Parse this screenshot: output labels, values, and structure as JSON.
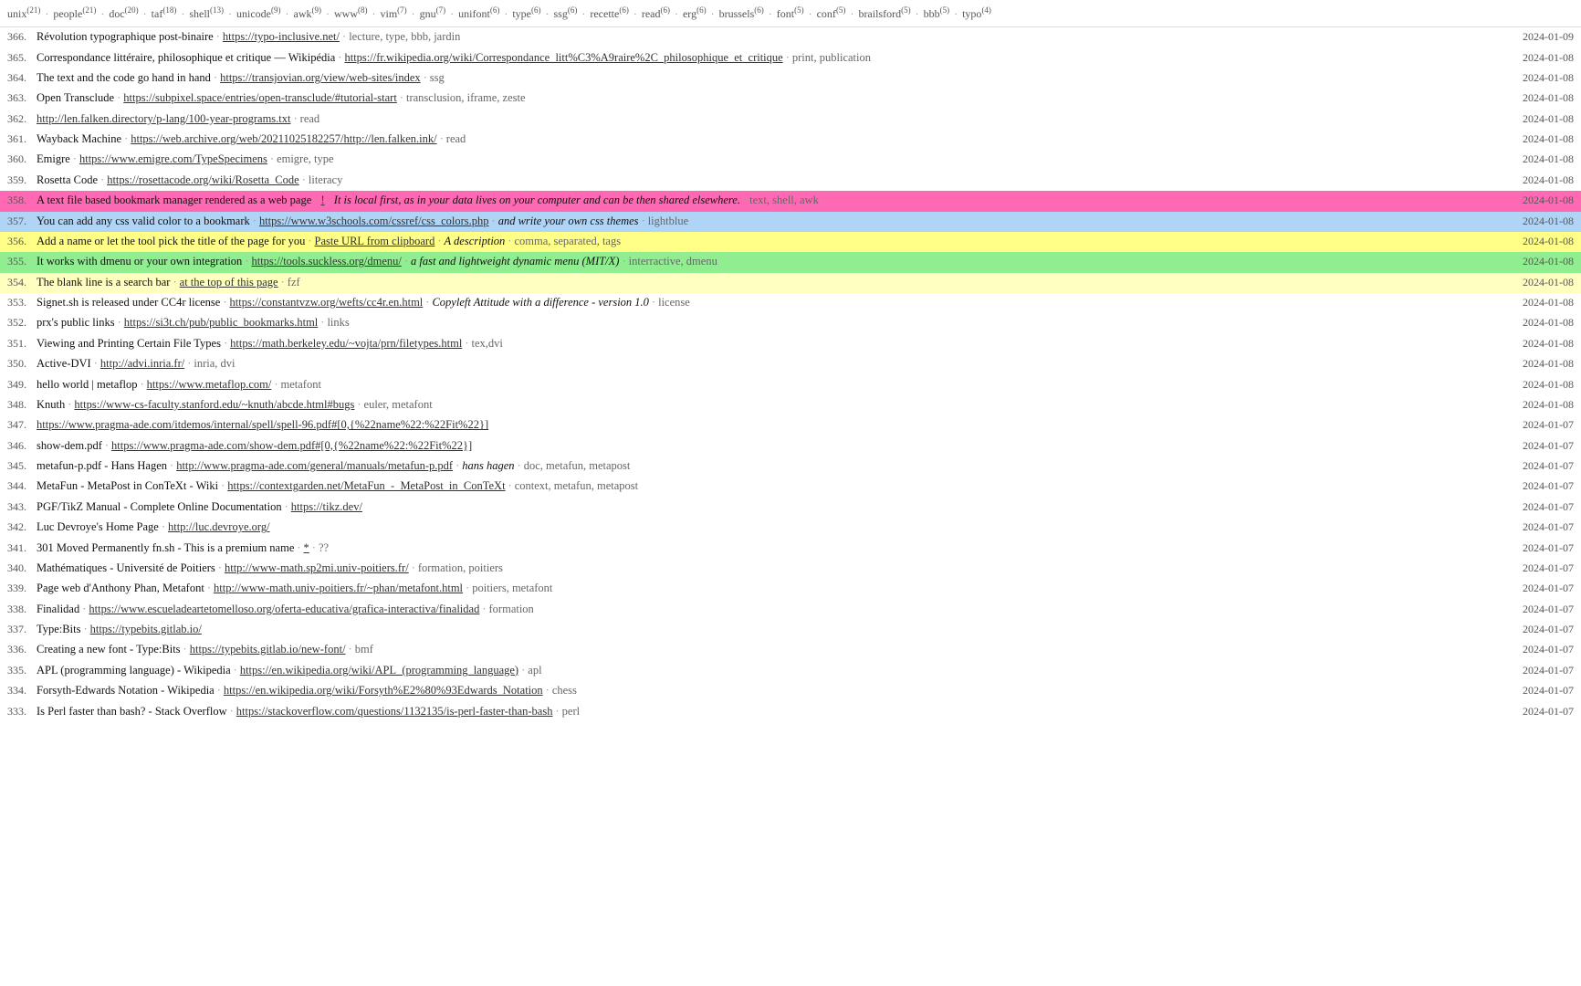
{
  "topbar": {
    "tags": [
      {
        "label": "unix",
        "count": "21"
      },
      {
        "label": "people",
        "count": "21"
      },
      {
        "label": "doc",
        "count": "20"
      },
      {
        "label": "taf",
        "count": "18"
      },
      {
        "label": "shell",
        "count": "13"
      },
      {
        "label": "unicode",
        "count": "9"
      },
      {
        "label": "awk",
        "count": "9"
      },
      {
        "label": "www",
        "count": "8"
      },
      {
        "label": "vim",
        "count": "7"
      },
      {
        "label": "gnu",
        "count": "7"
      },
      {
        "label": "unifont",
        "count": "6"
      },
      {
        "label": "type",
        "count": "6"
      },
      {
        "label": "ssg",
        "count": "6"
      },
      {
        "label": "recette",
        "count": "6"
      },
      {
        "label": "read",
        "count": "6"
      },
      {
        "label": "erg",
        "count": "6"
      },
      {
        "label": "brussels",
        "count": "6"
      },
      {
        "label": "font",
        "count": "5"
      },
      {
        "label": "conf",
        "count": "5"
      },
      {
        "label": "brailsford",
        "count": "5"
      },
      {
        "label": "bbb",
        "count": "5"
      },
      {
        "label": "typo",
        "count": "4"
      }
    ]
  },
  "rows": [
    {
      "num": "366",
      "text": "Révolution typographique post-binaire",
      "url": "https://typo-inclusive.net/",
      "tags": "lecture, type, bbb, jardin",
      "date": "2024-01-09",
      "bg": ""
    },
    {
      "num": "365",
      "text": "Correspondance littéraire, philosophique et critique — Wikipédia",
      "url": "https://fr.wikipedia.org/wiki/Correspondance_litt%C3%A9raire%2C_philosophique_et_critique",
      "tags": "print, publication",
      "date": "2024-01-08",
      "bg": ""
    },
    {
      "num": "364",
      "text": "The text and the code go hand in hand",
      "url": "https://transjovian.org/view/web-sites/index",
      "tags": "ssg",
      "date": "2024-01-08",
      "bg": ""
    },
    {
      "num": "363",
      "text": "Open Transclude",
      "url": "https://subpixel.space/entries/open-transclude/#tutorial-start",
      "tags": "transclusion, iframe, zeste",
      "date": "2024-01-08",
      "bg": ""
    },
    {
      "num": "362",
      "text": "",
      "url": "http://len.falken.directory/p-lang/100-year-programs.txt",
      "tags": "read",
      "date": "2024-01-08",
      "bg": ""
    },
    {
      "num": "361",
      "text": "Wayback Machine",
      "url": "https://web.archive.org/web/20211025182257/http://len.falken.ink/",
      "tags": "read",
      "date": "2024-01-08",
      "bg": ""
    },
    {
      "num": "360",
      "text": "Emigre",
      "url": "https://www.emigre.com/TypeSpecimens",
      "tags": "emigre, type",
      "date": "2024-01-08",
      "bg": ""
    },
    {
      "num": "359",
      "text": "Rosetta Code",
      "url": "https://rosettacode.org/wiki/Rosetta_Code",
      "tags": "literacy",
      "date": "2024-01-08",
      "bg": ""
    },
    {
      "num": "358",
      "text": "A text file based bookmark manager rendered as a web page",
      "url": "!",
      "url_text": "!",
      "italic_text": "It is local first, as in your data lives on your computer and can be then shared elsewhere.",
      "tags": "text, shell, awk",
      "date": "2024-01-08",
      "bg": "pink"
    },
    {
      "num": "357",
      "text": "You can add any css valid color to a bookmark",
      "url": "https://www.w3schools.com/cssref/css_colors.php",
      "italic_text": "and write your own css themes",
      "tags": "lightblue",
      "date": "2024-01-08",
      "bg": "lightblue"
    },
    {
      "num": "356",
      "text": "Add a name or let the tool pick the title of the page for you",
      "url": "Paste URL from clipboard",
      "italic_text": "A description",
      "tags": "comma, separated, tags",
      "date": "2024-01-08",
      "bg": "yellow"
    },
    {
      "num": "355",
      "text": "It works with dmenu or your own integration",
      "url": "https://tools.suckless.org/dmenu/",
      "italic_text": "a fast and lightweight dynamic menu (MIT/X)",
      "tags": "interractive, dmenu",
      "date": "2024-01-08",
      "bg": "lightgreen"
    },
    {
      "num": "354",
      "text": "The blank line is a search bar",
      "url": "at the top of this page",
      "tags": "fzf",
      "date": "2024-01-08",
      "bg": "lightyellow"
    },
    {
      "num": "353",
      "text": "Signet.sh is released under CC4r license",
      "url": "https://constantvzw.org/wefts/cc4r.en.html",
      "italic_text": "Copyleft Attitude with a difference - version 1.0",
      "tags": "license",
      "date": "2024-01-08",
      "bg": ""
    },
    {
      "num": "352",
      "text": "prx's public links",
      "url": "https://si3t.ch/pub/public_bookmarks.html",
      "tags": "links",
      "date": "2024-01-08",
      "bg": ""
    },
    {
      "num": "351",
      "text": "Viewing and Printing Certain File Types",
      "url": "https://math.berkeley.edu/~vojta/prn/filetypes.html",
      "tags": "tex,dvi",
      "date": "2024-01-08",
      "bg": ""
    },
    {
      "num": "350",
      "text": "Active-DVI",
      "url": "http://advi.inria.fr/",
      "tags": "inria, dvi",
      "date": "2024-01-08",
      "bg": ""
    },
    {
      "num": "349",
      "text": "hello world | metaflop",
      "url": "https://www.metaflop.com/",
      "tags": "metafont",
      "date": "2024-01-08",
      "bg": ""
    },
    {
      "num": "348",
      "text": "Knuth",
      "url": "https://www-cs-faculty.stanford.edu/~knuth/abcde.html#bugs",
      "tags": "euler, metafont",
      "date": "2024-01-08",
      "bg": ""
    },
    {
      "num": "347",
      "text": "",
      "url": "https://www.pragma-ade.com/itdemos/internal/spell/spell-96.pdf#[0,{%22name%22:%22Fit%22}]",
      "tags": "",
      "date": "2024-01-07",
      "bg": ""
    },
    {
      "num": "346",
      "text": "show-dem.pdf",
      "url": "https://www.pragma-ade.com/show-dem.pdf#[0,{%22name%22:%22Fit%22}]",
      "tags": "",
      "date": "2024-01-07",
      "bg": ""
    },
    {
      "num": "345",
      "text": "metafun-p.pdf - Hans Hagen",
      "url": "http://www.pragma-ade.com/general/manuals/metafun-p.pdf",
      "italic_text": "hans hagen",
      "tags": "doc, metafun, metapost",
      "date": "2024-01-07",
      "bg": ""
    },
    {
      "num": "344",
      "text": "MetaFun - MetaPost in ConTeXt - Wiki",
      "url": "https://contextgarden.net/MetaFun_-_MetaPost_in_ConTeXt",
      "tags": "context, metafun, metapost",
      "date": "2024-01-07",
      "bg": ""
    },
    {
      "num": "343",
      "text": "PGF/TikZ Manual - Complete Online Documentation",
      "url": "https://tikz.dev/",
      "tags": "",
      "date": "2024-01-07",
      "bg": ""
    },
    {
      "num": "342",
      "text": "Luc Devroye's Home Page",
      "url": "http://luc.devroye.org/",
      "tags": "",
      "date": "2024-01-07",
      "bg": ""
    },
    {
      "num": "341",
      "text": "301 Moved Permanently fn.sh - This is a premium name",
      "url": "*",
      "tags": "??",
      "date": "2024-01-07",
      "bg": ""
    },
    {
      "num": "340",
      "text": "Mathématiques - Université de Poitiers",
      "url": "http://www-math.sp2mi.univ-poitiers.fr/",
      "tags": "formation, poitiers",
      "date": "2024-01-07",
      "bg": ""
    },
    {
      "num": "339",
      "text": "Page web d'Anthony Phan, Metafont",
      "url": "http://www-math.univ-poitiers.fr/~phan/metafont.html",
      "tags": "poitiers, metafont",
      "date": "2024-01-07",
      "bg": ""
    },
    {
      "num": "338",
      "text": "Finalidad",
      "url": "https://www.escueladeartetomelloso.org/oferta-educativa/grafica-interactiva/finalidad",
      "tags": "formation",
      "date": "2024-01-07",
      "bg": ""
    },
    {
      "num": "337",
      "text": "Type:Bits",
      "url": "https://typebits.gitlab.io/",
      "tags": "",
      "date": "2024-01-07",
      "bg": ""
    },
    {
      "num": "336",
      "text": "Creating a new font - Type:Bits",
      "url": "https://typebits.gitlab.io/new-font/",
      "tags": "bmf",
      "date": "2024-01-07",
      "bg": ""
    },
    {
      "num": "335",
      "text": "APL (programming language) - Wikipedia",
      "url": "https://en.wikipedia.org/wiki/APL_(programming_language)",
      "tags": "apl",
      "date": "2024-01-07",
      "bg": ""
    },
    {
      "num": "334",
      "text": "Forsyth-Edwards Notation - Wikipedia",
      "url": "https://en.wikipedia.org/wiki/Forsyth%E2%80%93Edwards_Notation",
      "tags": "chess",
      "date": "2024-01-07",
      "bg": ""
    },
    {
      "num": "333",
      "text": "Is Perl faster than bash? - Stack Overflow",
      "url": "https://stackoverflow.com/questions/1132135/is-perl-faster-than-bash",
      "tags": "perl",
      "date": "2024-01-07",
      "bg": ""
    }
  ]
}
